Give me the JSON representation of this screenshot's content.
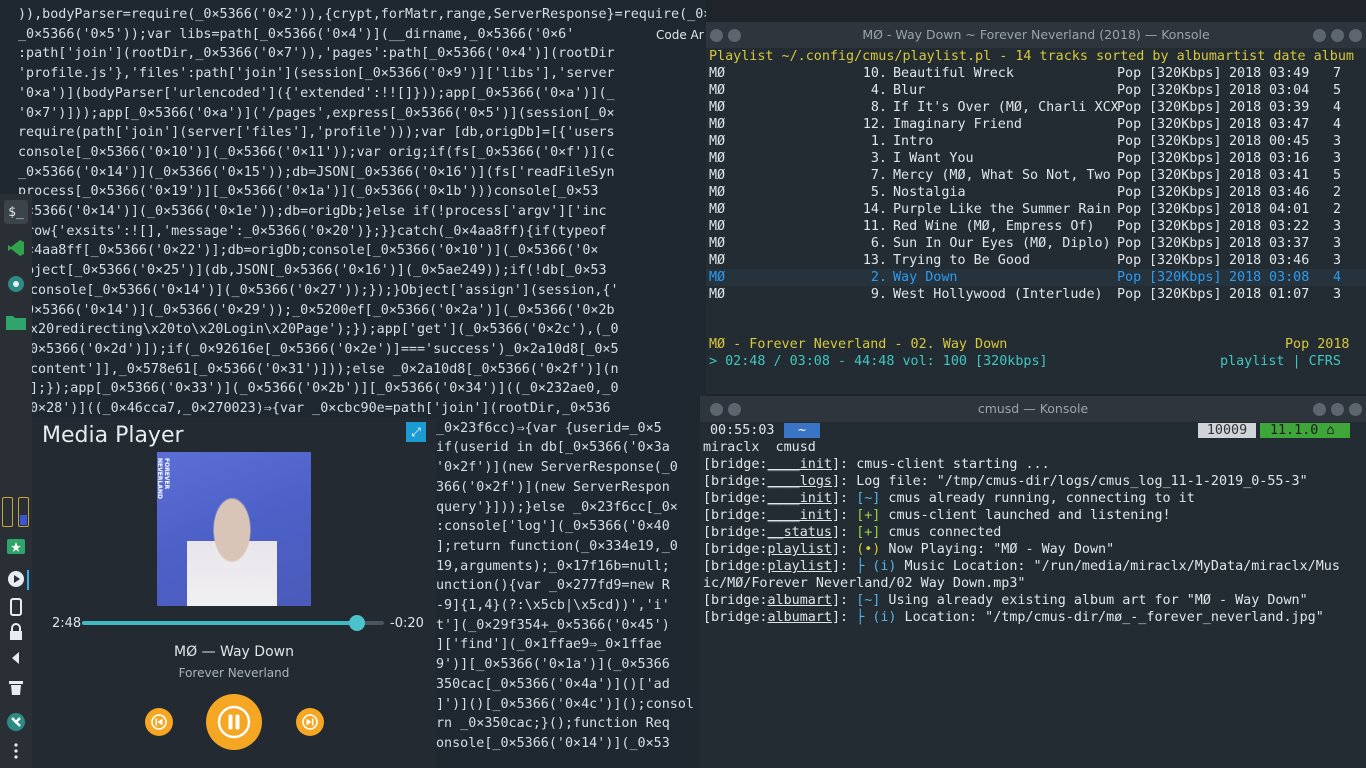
{
  "code_editor": {
    "tooltip": "Code Ar",
    "lines": [
      ")),bodyParser=require(_0×5366('0×2')),{crypt,forMatr,range,ServerResponse}=require(_0×5366('0×3'));var rootDir=path[_0×5366('0×4')](__dirname,",
      "_0×5366('0×5'));var libs=path[_0×5366('0×4')](__dirname,_0×5366('0×6'",
      ":path['join'](rootDir,_0×5366('0×7')),'pages':path[_0×5366('0×4')](rootDir",
      "'profile.js'},'files':path['join'](session[_0×5366('0×9')]['libs'],'server",
      "'0×a')](bodyParser['urlencoded']({'extended':!![]}));app[_0×5366('0×a')](_",
      "'0×7')]));app[_0×5366('0×a')]('/pages',express[_0×5366('0×5')](session[_0×",
      "require(path['join'](server['files'],'profile')));var [db,origDb]=[{'users",
      "console[_0×5366('0×10')](_0×5366('0×11'));var orig;if(fs[_0×5366('0×f')](c",
      "_0×5366('0×14')](_0×5366('0×15'));db=JSON[_0×5366('0×16')](fs['readFileSyn",
      "process[_0×5366('0×19')][_0×5366('0×1a')](_0×5366('0×1b')))console[_0×53",
      "0×5366('0×14')](_0×5366('0×1e'));db=origDb;}else if(!process['argv']['inc",
      "hrow{'exsits':![],'message':_0×5366('0×20')};}}catch(_0×4aa8ff){if(typeof",
      "0×4aa8ff[_0×5366('0×22')];db=origDb;console[_0×5366('0×10')](_0×5366('0×",
      "Object[_0×5366('0×25')](db,JSON[_0×5366('0×16')](_0×5ae249));if(!db[_0×53",
      "console[_0×5366('0×14')](_0×5366('0×27'));});}Object['assign'](session,{'",
      "_0×5366('0×14')](_0×5366('0×29'));_0×5200ef[_0×5366('0×2a')](_0×5366('0×2b",
      "x20redirecting\\x20to\\x20Login\\x20Page');});app['get'](_0×5366('0×2c'),(_0",
      "0×5366('0×2d')]);if(_0×92616e[_0×5366('0×2e')]==='success')_0×2a10d8[_0×5",
      "content']],_0×578e61[_0×5366('0×31')]));else _0×2a10d8[_0×5366('0×2f')](n",
      "];});app[_0×5366('0×33')](_0×5366('0×2b')][_0×5366('0×34')]((_0×232ae0,_0",
      "0×28')]((_0×46cca7,_0×270023)⇒{var _0×cbc90e=path['join'](rootDir,_0×536",
      "_0×23f6cc)⇒{var {userid=_0×5",
      "if(userid in db[_0×5366('0×3a",
      "'0×2f')](new ServerResponse(_0",
      "366('0×2f')](new ServerRespon",
      "query'}]));}else _0×23f6cc[_0×",
      ":console['log'](_0×5366('0×40",
      "];return function(_0×334e19,_0",
      "19,arguments);_0×17f16b=null;",
      "unction(){var _0×277fd9=new R",
      "-9]{1,4}(?:\\x5cb|\\x5cd))','i'",
      "t'](_0×29f354+_0×5366('0×45')",
      "]['find'](_0×1ffae9⇒_0×1ffae",
      "9')][_0×5366('0×1a')](_0×5366",
      "350cac[_0×5366('0×4a')]()['ad",
      "]')]()[_0×5366('0×4c')]();consol",
      "rn _0×350cac;}();function Req",
      "onsole[_0×5366('0×14')](_0×53",
      "]]+'`');}function getLibPath("
    ]
  },
  "media_player": {
    "title": "Media Player",
    "pin_icon": "pin-icon",
    "album_spine_text": "FOREVER NEVERLAND",
    "time_elapsed": "2:48",
    "time_remaining": "-0:20",
    "progress_fraction": 0.91,
    "song": "MØ — Way Down",
    "album": "Forever Neverland",
    "accent_color": "#f5a623",
    "slider_color": "#3fb9c2"
  },
  "cmus_window": {
    "title": "MØ - Way Down ~ Forever Neverland (2018) — Konsole",
    "header": "Playlist ~/.config/cmus/playlist.pl - 14 tracks sorted by albumartist date album",
    "columns": [
      "artist",
      "track",
      "title",
      "genre",
      "bitrate",
      "year",
      "duration",
      "plays"
    ],
    "tracks": [
      {
        "artist": "MØ",
        "num": "10.",
        "title": "Beautiful Wreck",
        "genre": "Pop",
        "bitrate": "[320Kbps]",
        "year": "2018",
        "dur": "03:49",
        "plays": "7",
        "current": false
      },
      {
        "artist": "MØ",
        "num": "4.",
        "title": "Blur",
        "genre": "Pop",
        "bitrate": "[320Kbps]",
        "year": "2018",
        "dur": "03:04",
        "plays": "5",
        "current": false
      },
      {
        "artist": "MØ",
        "num": "8.",
        "title": "If It's Over (MØ, Charli XCX",
        "genre": "Pop",
        "bitrate": "[320Kbps]",
        "year": "2018",
        "dur": "03:39",
        "plays": "4",
        "current": false
      },
      {
        "artist": "MØ",
        "num": "12.",
        "title": "Imaginary Friend",
        "genre": "Pop",
        "bitrate": "[320Kbps]",
        "year": "2018",
        "dur": "03:47",
        "plays": "4",
        "current": false
      },
      {
        "artist": "MØ",
        "num": "1.",
        "title": "Intro",
        "genre": "Pop",
        "bitrate": "[320Kbps]",
        "year": "2018",
        "dur": "00:45",
        "plays": "3",
        "current": false
      },
      {
        "artist": "MØ",
        "num": "3.",
        "title": "I Want You",
        "genre": "Pop",
        "bitrate": "[320Kbps]",
        "year": "2018",
        "dur": "03:16",
        "plays": "3",
        "current": false
      },
      {
        "artist": "MØ",
        "num": "7.",
        "title": "Mercy (MØ, What So Not, Two",
        "genre": "Pop",
        "bitrate": "[320Kbps]",
        "year": "2018",
        "dur": "03:41",
        "plays": "5",
        "current": false
      },
      {
        "artist": "MØ",
        "num": "5.",
        "title": "Nostalgia",
        "genre": "Pop",
        "bitrate": "[320Kbps]",
        "year": "2018",
        "dur": "03:46",
        "plays": "2",
        "current": false
      },
      {
        "artist": "MØ",
        "num": "14.",
        "title": "Purple Like the Summer Rain",
        "genre": "Pop",
        "bitrate": "[320Kbps]",
        "year": "2018",
        "dur": "04:01",
        "plays": "2",
        "current": false
      },
      {
        "artist": "MØ",
        "num": "11.",
        "title": "Red Wine (MØ, Empress Of)",
        "genre": "Pop",
        "bitrate": "[320Kbps]",
        "year": "2018",
        "dur": "03:22",
        "plays": "3",
        "current": false
      },
      {
        "artist": "MØ",
        "num": "6.",
        "title": "Sun In Our Eyes (MØ, Diplo)",
        "genre": "Pop",
        "bitrate": "[320Kbps]",
        "year": "2018",
        "dur": "03:37",
        "plays": "3",
        "current": false
      },
      {
        "artist": "MØ",
        "num": "13.",
        "title": "Trying to Be Good",
        "genre": "Pop",
        "bitrate": "[320Kbps]",
        "year": "2018",
        "dur": "03:46",
        "plays": "3",
        "current": false
      },
      {
        "artist": "MØ",
        "num": "2.",
        "title": "Way Down",
        "genre": "Pop",
        "bitrate": "[320Kbps]",
        "year": "2018",
        "dur": "03:08",
        "plays": "4",
        "current": true
      },
      {
        "artist": "MØ",
        "num": "9.",
        "title": "West Hollywood (Interlude)",
        "genre": "Pop",
        "bitrate": "[320Kbps]",
        "year": "2018",
        "dur": "01:07",
        "plays": "3",
        "current": false
      }
    ],
    "now_playing": "MØ - Forever Neverland - 02. Way Down",
    "now_playing_right": "Pop 2018",
    "status_left": "> 02:48 / 03:08 - 44:48 vol: 100 [320kbps]",
    "status_right": "playlist | CFRS"
  },
  "cmusd_window": {
    "title": "cmusd — Konsole",
    "prompt_time": "00:55:03",
    "prompt_dir": "~",
    "prompt_count": "10009",
    "prompt_version": "11.1.0",
    "user_line": "miraclx  cmusd",
    "log": [
      {
        "prefix": "[bridge:",
        "mod": "____init",
        "sep": "]: ",
        "mark": "",
        "msg": "cmus-client starting ..."
      },
      {
        "prefix": "[bridge:",
        "mod": "____logs",
        "sep": "]: ",
        "mark": "",
        "msg": "Log file: \"/tmp/cmus-dir/logs/cmus_log_11-1-2019_0-55-3\""
      },
      {
        "prefix": "[bridge:",
        "mod": "____init",
        "sep": "]: ",
        "mark": "[~]",
        "msg": " cmus already running, connecting to it"
      },
      {
        "prefix": "[bridge:",
        "mod": "____init",
        "sep": "]: ",
        "mark": "[+]",
        "msg": " cmus-client launched and listening!"
      },
      {
        "prefix": "[bridge:",
        "mod": "__status",
        "sep": "]: ",
        "mark": "[+]",
        "msg": " cmus connected"
      },
      {
        "prefix": "[bridge:",
        "mod": "playlist",
        "sep": "]: ",
        "mark": "(•)",
        "msg": " Now Playing: \"MØ - Way Down\""
      },
      {
        "prefix": "[bridge:",
        "mod": "playlist",
        "sep": "]: ",
        "mark": "├ (i)",
        "msg": " Music Location: \"/run/media/miraclx/MyData/miraclx/Mus"
      },
      {
        "prefix": "",
        "mod": "",
        "sep": "",
        "mark": "",
        "msg": "ic/MØ/Forever Neverland/02 Way Down.mp3\""
      },
      {
        "prefix": "[bridge:",
        "mod": "albumart",
        "sep": "]: ",
        "mark": "[~]",
        "msg": " Using already existing album art for \"MØ - Way Down\""
      },
      {
        "prefix": "[bridge:",
        "mod": "albumart",
        "sep": "]: ",
        "mark": "├ (i)",
        "msg": " Location: \"/tmp/cmus-dir/mø_-_forever_neverland.jpg\""
      }
    ]
  },
  "dock": {
    "items": [
      "terminal-icon",
      "code-icon",
      "network-icon",
      "folder-icon",
      "star-icon",
      "play-icon",
      "phone-icon",
      "lock-icon",
      "arrow-left-icon",
      "trash-icon",
      "settings-icon",
      "more-icon"
    ]
  }
}
